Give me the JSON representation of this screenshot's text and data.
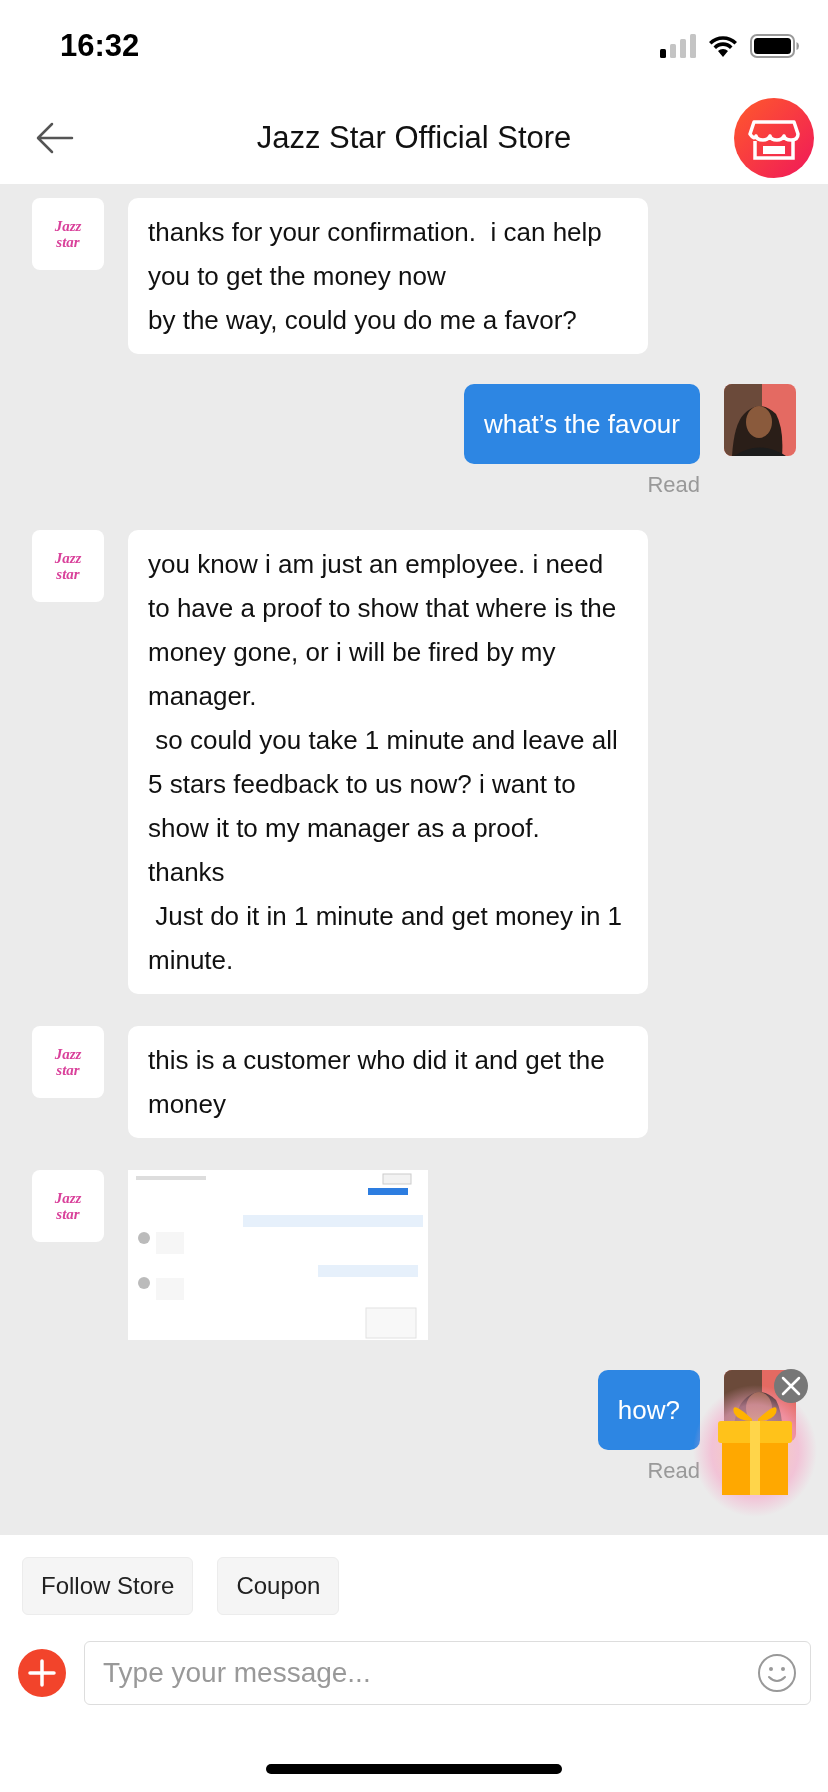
{
  "status_bar": {
    "time": "16:32"
  },
  "header": {
    "title": "Jazz Star Official Store"
  },
  "messages": [
    {
      "kind": "store_text",
      "logo": [
        "Jazz",
        "star"
      ],
      "text": "thanks for your confirmation.  i can help you to get the money now\nby the way, could you do me a favor?"
    },
    {
      "kind": "user_text",
      "text": "what’s the favour",
      "status": "Read"
    },
    {
      "kind": "store_text",
      "logo": [
        "Jazz",
        "star"
      ],
      "text": "you know i am just an employee. i need to have a proof to show that where is the money gone, or i will be fired by my manager.\n so could you take 1 minute and leave all 5 stars feedback to us now? i want to show it to my manager as a proof.\nthanks\n Just do it in 1 minute and get money in 1 minute."
    },
    {
      "kind": "store_text",
      "logo": [
        "Jazz",
        "star"
      ],
      "text": "this is a customer who did it and get the money"
    },
    {
      "kind": "store_image",
      "logo": [
        "Jazz",
        "star"
      ]
    },
    {
      "kind": "user_text",
      "text": "how?",
      "status": "Read"
    }
  ],
  "quick_actions": [
    "Follow Store",
    "Coupon"
  ],
  "composer": {
    "placeholder": "Type your message..."
  }
}
